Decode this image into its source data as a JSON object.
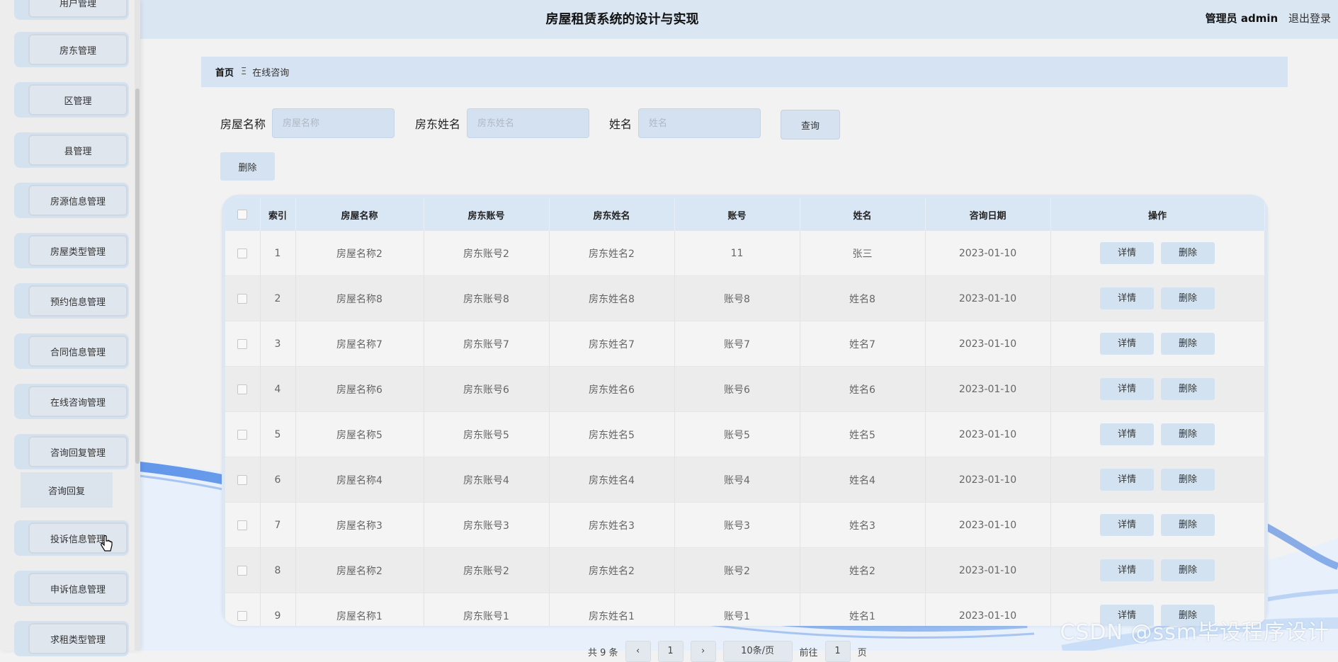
{
  "header": {
    "title": "房屋租赁系统的设计与实现",
    "admin_label": "管理员 admin",
    "logout": "退出登录"
  },
  "sidebar": {
    "items": [
      {
        "label": "用户管理"
      },
      {
        "label": "房东管理"
      },
      {
        "label": "区管理"
      },
      {
        "label": "县管理"
      },
      {
        "label": "房源信息管理"
      },
      {
        "label": "房屋类型管理"
      },
      {
        "label": "预约信息管理"
      },
      {
        "label": "合同信息管理"
      },
      {
        "label": "在线咨询管理"
      },
      {
        "label": "咨询回复管理"
      },
      {
        "label": "投诉信息管理"
      },
      {
        "label": "申诉信息管理"
      },
      {
        "label": "求租类型管理"
      }
    ],
    "submenu": {
      "label": "咨询回复"
    }
  },
  "breadcrumb": {
    "home": "首页",
    "separator": "Ξ",
    "current": "在线咨询"
  },
  "search": {
    "house_name_label": "房屋名称",
    "house_name_placeholder": "房屋名称",
    "landlord_name_label": "房东姓名",
    "landlord_name_placeholder": "房东姓名",
    "name_label": "姓名",
    "name_placeholder": "姓名",
    "query_button": "查询"
  },
  "toolbar": {
    "delete_button": "删除"
  },
  "table": {
    "columns": [
      "",
      "索引",
      "房屋名称",
      "房东账号",
      "房东姓名",
      "账号",
      "姓名",
      "咨询日期",
      "操作"
    ],
    "detail_label": "详情",
    "delete_label": "删除",
    "rows": [
      {
        "index": "1",
        "house_name": "房屋名称2",
        "landlord_account": "房东账号2",
        "landlord_name": "房东姓名2",
        "account": "11",
        "name": "张三",
        "date": "2023-01-10"
      },
      {
        "index": "2",
        "house_name": "房屋名称8",
        "landlord_account": "房东账号8",
        "landlord_name": "房东姓名8",
        "account": "账号8",
        "name": "姓名8",
        "date": "2023-01-10"
      },
      {
        "index": "3",
        "house_name": "房屋名称7",
        "landlord_account": "房东账号7",
        "landlord_name": "房东姓名7",
        "account": "账号7",
        "name": "姓名7",
        "date": "2023-01-10"
      },
      {
        "index": "4",
        "house_name": "房屋名称6",
        "landlord_account": "房东账号6",
        "landlord_name": "房东姓名6",
        "account": "账号6",
        "name": "姓名6",
        "date": "2023-01-10"
      },
      {
        "index": "5",
        "house_name": "房屋名称5",
        "landlord_account": "房东账号5",
        "landlord_name": "房东姓名5",
        "account": "账号5",
        "name": "姓名5",
        "date": "2023-01-10"
      },
      {
        "index": "6",
        "house_name": "房屋名称4",
        "landlord_account": "房东账号4",
        "landlord_name": "房东姓名4",
        "account": "账号4",
        "name": "姓名4",
        "date": "2023-01-10"
      },
      {
        "index": "7",
        "house_name": "房屋名称3",
        "landlord_account": "房东账号3",
        "landlord_name": "房东姓名3",
        "account": "账号3",
        "name": "姓名3",
        "date": "2023-01-10"
      },
      {
        "index": "8",
        "house_name": "房屋名称2",
        "landlord_account": "房东账号2",
        "landlord_name": "房东姓名2",
        "account": "账号2",
        "name": "姓名2",
        "date": "2023-01-10"
      },
      {
        "index": "9",
        "house_name": "房屋名称1",
        "landlord_account": "房东账号1",
        "landlord_name": "房东姓名1",
        "account": "账号1",
        "name": "姓名1",
        "date": "2023-01-10"
      }
    ]
  },
  "pagination": {
    "total": "共 9 条",
    "current_page": "1",
    "page_size": "10条/页",
    "goto_prefix": "前往",
    "goto_value": "1",
    "goto_suffix": "页"
  },
  "watermark": "CSDN @ssm毕设程序设计",
  "colors": {
    "header_bg": "#dbe6f3",
    "accent_blue": "#d4e2f2",
    "sidebar_item_bg": "#d4e1ef",
    "wave_blue": "#3d7be0"
  }
}
